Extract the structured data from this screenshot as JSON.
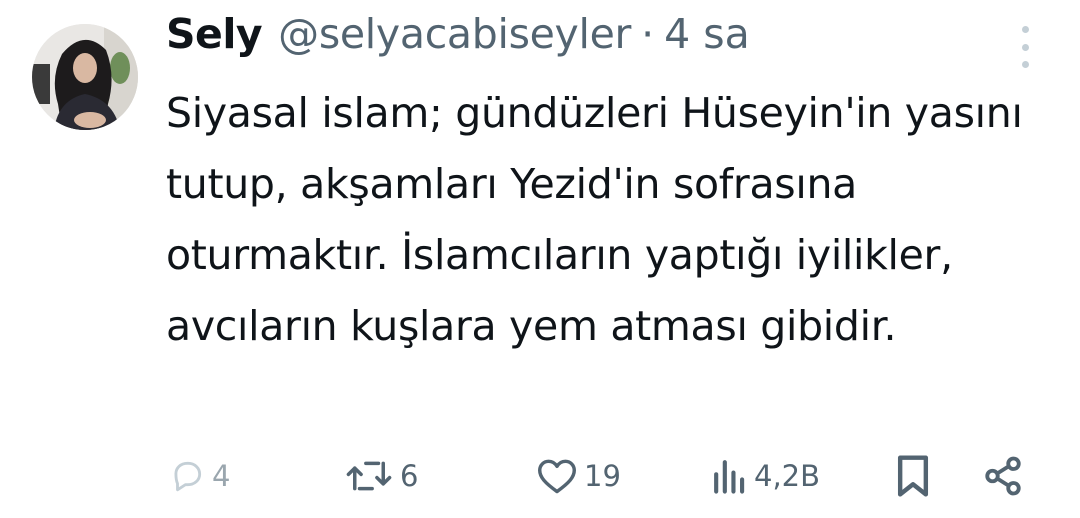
{
  "tweet": {
    "author_name": "Sely",
    "handle": "@selyacabiseyler",
    "separator": "·",
    "time": "4 sa",
    "text": "Siyasal islam; gündüzleri Hüseyin'in yasını tutup, akşamları Yezid'in sofrasına oturmaktır. İslamcıların yaptığı iyilikler, avcıların kuşlara yem atması gibidir."
  },
  "actions": {
    "reply": {
      "icon": "reply-icon",
      "count": "4"
    },
    "retweet": {
      "icon": "retweet-icon",
      "count": "6"
    },
    "like": {
      "icon": "heart-icon",
      "count": "19"
    },
    "views": {
      "icon": "views-icon",
      "count": "4,2B"
    },
    "bookmark": {
      "icon": "bookmark-icon"
    },
    "share": {
      "icon": "share-icon"
    }
  },
  "colors": {
    "text": "#0f1419",
    "muted": "#536471",
    "reply_icon": "#c4cfd6",
    "background": "#ffffff"
  }
}
